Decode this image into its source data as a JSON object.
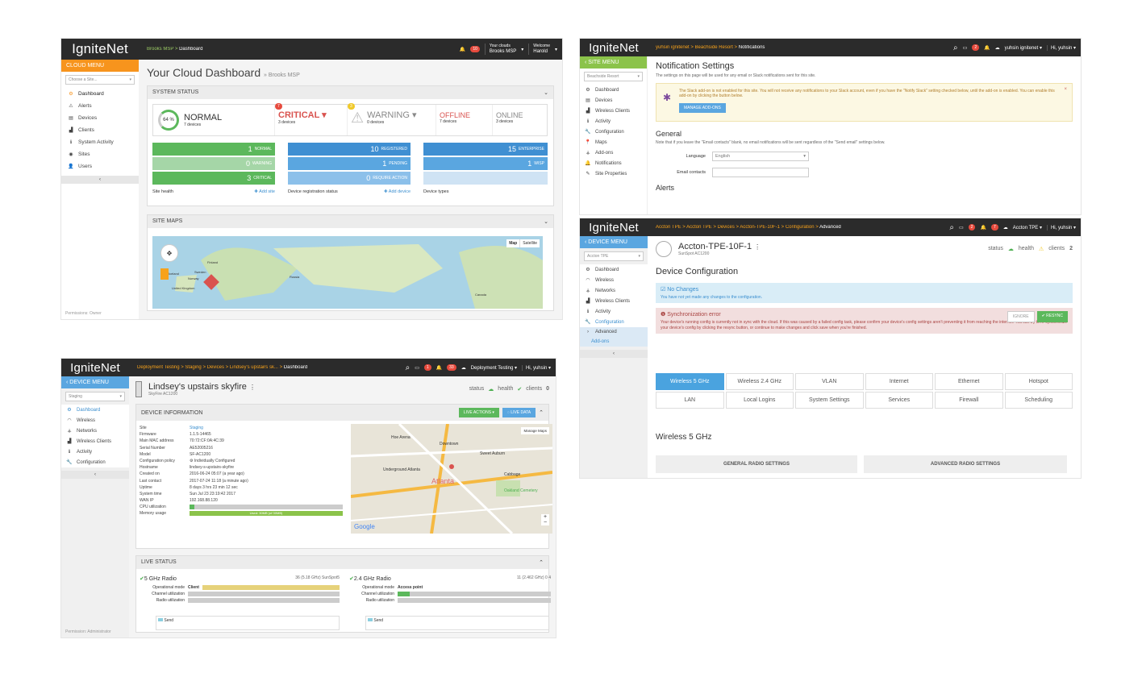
{
  "p1": {
    "logo": "IgniteNet",
    "breadcrumb": "Brooks MSP > ",
    "breadcrumb_current": "Dashboard",
    "alert_count": "10",
    "clouds_label": "Your clouds",
    "clouds_value": "Brooks MSP",
    "welcome_label": "Welcome",
    "welcome_user": "Harold",
    "side_head": "CLOUD MENU",
    "site_select": "Choose a Site...",
    "menu": [
      "Dashboard",
      "Alerts",
      "Devices",
      "Clients",
      "System Activity",
      "Sites",
      "Users"
    ],
    "collapse": "‹",
    "permissions": "Permissions: Owner",
    "title": "Your Cloud Dashboard",
    "title_sub": "» Brooks MSP",
    "system_status": "SYSTEM STATUS",
    "percent": "64 %",
    "normal": "NORMAL",
    "normal_devices": "7 devices",
    "critical_badge": "7",
    "critical": "CRITICAL ▾",
    "critical_devices": "3 devices",
    "warning_badge": "3",
    "warning": "WARNING ▾",
    "warning_devices": "0 devices",
    "offline": "OFFLINE",
    "offline_devices": "7 devices",
    "online": "ONLINE",
    "online_devices": "3 devices",
    "health_rows": [
      {
        "n": "1",
        "label": "NORMAL"
      },
      {
        "n": "0",
        "label": "WARNING"
      },
      {
        "n": "3",
        "label": "CRITICAL"
      }
    ],
    "reg_rows": [
      {
        "n": "10",
        "label": "REGISTERED"
      },
      {
        "n": "1",
        "label": "PENDING"
      },
      {
        "n": "0",
        "label": "REQUIRE ACTION"
      }
    ],
    "type_rows": [
      {
        "n": "15",
        "label": "ENTERPRISE"
      },
      {
        "n": "1",
        "label": "WISP"
      }
    ],
    "site_health": "Site health",
    "add_site": "✚ Add site",
    "device_reg": "Device registration status",
    "add_device": "✚ Add device",
    "device_types": "Device types",
    "site_maps": "SITE MAPS",
    "map_btn": "Map",
    "sat_btn": "Satellite",
    "map_labels": [
      "Finland",
      "Sweden",
      "Norway",
      "Russia",
      "Iceland",
      "Canada",
      "United Kingdom"
    ]
  },
  "p2": {
    "logo": "IgniteNet",
    "breadcrumb": "yuhsin ignitenet > Beachside Resort > ",
    "breadcrumb_current": "Notifications",
    "badge": "2",
    "user_cloud": "yuhsin ignitenet ▾",
    "hi": "Hi, yuhsin ▾",
    "side_head": "‹  SITE MENU",
    "site_select": "Beachside Resort",
    "menu": [
      "Dashboard",
      "Devices",
      "Wireless Clients",
      "Activity",
      "Configuration",
      "Maps",
      "Add-ons",
      "Notifications",
      "Site Properties"
    ],
    "title": "Notification Settings",
    "intro": "The settings on this page will be used for any email or Slack notifications sent for this site.",
    "slack_msg": "The Slack add-on is not enabled for this site. You will not receive any notifications to your Slack account, even if you have the \"Notify Slack\" setting checked below, until the add-on is enabled. You can enable this add-on by clicking the button below.",
    "manage_btn": "MANAGE ADD-ONS",
    "general": "General",
    "general_note": "Note that if you leave the \"Email contacts\" blank, no email notifications will be sent regardless of the \"Send email\" settings below.",
    "language_label": "Language",
    "language_value": "English",
    "email_label": "Email contacts",
    "alerts_heading": "Alerts"
  },
  "p3": {
    "logo": "IgniteNet",
    "breadcrumb": "Accton TPE > Accton TPE > Devices > Accton-TPE-10F-1 > Configuration > ",
    "breadcrumb_current": "Advanced",
    "badge1": "2",
    "badge2": "7",
    "cloud": "Accton TPE ▾",
    "hi": "Hi, yuhsin ▾",
    "side_head": "‹  DEVICE MENU",
    "site_select": "Accton TPE",
    "menu": [
      "Dashboard",
      "Wireless",
      "Networks",
      "Wireless Clients",
      "Activity",
      "Configuration",
      "Advanced",
      "Add-ons"
    ],
    "device_name": "Accton-TPE-10F-1",
    "device_model": "SunSpot AC1200",
    "status": "status",
    "health": "health",
    "clients": "clients",
    "clients_n": "2",
    "section": "Device Configuration",
    "nochange_title": "☑ No Changes",
    "nochange_msg": "You have not yet made any changes to the configuration.",
    "sync_title": "❶ Synchronization error",
    "sync_msg": "Your device's running config is currently not in sync with the cloud. If this was caused by a failed config task, please confirm your device's config settings aren't preventing it from reaching the internet. You can try to re-synchronize your device's config by clicking the resync button, or continue to make changes and click save when you're finished.",
    "ignore_btn": "IGNORE",
    "resync_btn": "✔ RESYNC",
    "tabs": [
      "Wireless 5 GHz",
      "Wireless 2.4 GHz",
      "VLAN",
      "Internet",
      "Ethernet",
      "Hotspot",
      "LAN",
      "Local Logins",
      "System Settings",
      "Services",
      "Firewall",
      "Scheduling"
    ],
    "sub_title": "Wireless 5 GHz",
    "general_radio": "GENERAL RADIO SETTINGS",
    "advanced_radio": "ADVANCED RADIO SETTINGS"
  },
  "p4": {
    "logo": "IgniteNet",
    "breadcrumb": "Deployment Testing > Staging > Devices > Lindsey's upstairs sk... > ",
    "breadcrumb_current": "Dashboard",
    "badge1": "1",
    "badge2": "33",
    "cloud": "Deployment Testing ▾",
    "hi": "Hi, yuhsin ▾",
    "side_head": "‹  DEVICE MENU",
    "site_select": "Staging",
    "menu": [
      "Dashboard",
      "Wireless",
      "Networks",
      "Wireless Clients",
      "Activity",
      "Configuration"
    ],
    "permissions": "Permission: Administrator",
    "device_name": "Lindsey's upstairs skyfire",
    "device_model": "SkyFire AC1200",
    "status": "status",
    "health": "health",
    "clients": "clients",
    "clients_n": "0",
    "info_title": "DEVICE INFORMATION",
    "live_actions": "LIVE ACTIONS ▾",
    "live_data": "◌ LIVE DATA",
    "info": [
      {
        "k": "Site",
        "v": "Staging"
      },
      {
        "k": "Firmware",
        "v": "1.1.5-14465"
      },
      {
        "k": "Main MAC address",
        "v": "70:72:CF:0A:4C:39"
      },
      {
        "k": "Serial Number",
        "v": "AE52005216"
      },
      {
        "k": "Model",
        "v": "SF-AC1200"
      },
      {
        "k": "Configuration policy",
        "v": "⚙ Individually Configured"
      },
      {
        "k": "Hostname",
        "v": "lindsey-s-upstairs-skyfire"
      },
      {
        "k": "Created on",
        "v": "2016-06-24 05:07 (a year ago)"
      },
      {
        "k": "Last contact",
        "v": "2017-07-24 11:18 (a minute ago)"
      },
      {
        "k": "Uptime",
        "v": "8 days 3 hrs 23 min 12 sec"
      },
      {
        "k": "System time",
        "v": "Sun Jul 23 23:19:42 2017"
      },
      {
        "k": "WAN IP",
        "v": "192.168.88.120"
      },
      {
        "k": "CPU utilization",
        "v": ""
      },
      {
        "k": "Memory usage",
        "v": ""
      }
    ],
    "cpu_pct": 0.03,
    "mem_pct": 1.0,
    "mem_text": "Used: 30MB (of 30MB)",
    "map_labels": [
      "Downtown",
      "Sweet Auburn",
      "Atlanta",
      "Cabbage",
      "Oakland Cemetery",
      "Underground Atlanta",
      "Hoe Arena"
    ],
    "manage_maps": "Manage Maps",
    "google": "Google",
    "live_status": "LIVE STATUS",
    "radio5": "5 GHz Radio",
    "radio5_info": "36 (5.18 GHz)  SunSpot5",
    "radio24": "2.4 GHz Radio",
    "radio24_info": "11 (2.462 GHz)  0  4",
    "op_mode": "Operational mode",
    "op5": "Client",
    "op24": "Access point",
    "ch_util": "Channel utilization",
    "radio_util": "Radio utilization",
    "send": "Send"
  }
}
